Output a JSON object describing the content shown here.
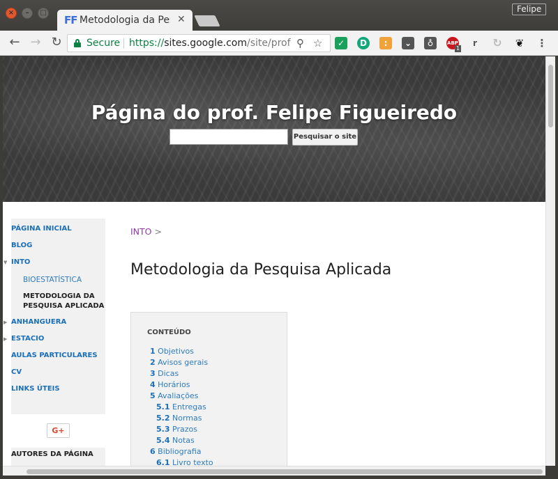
{
  "browser": {
    "tab_title": "Metodologia da Pesquisa Aplicada",
    "tab_close": "✕",
    "profile": "Felipe",
    "secure_label": "Secure",
    "url_scheme": "https://",
    "url_host": "sites.google.com",
    "url_path": "/site/prof...",
    "icons": [
      "back-icon",
      "forward-icon",
      "reload-icon",
      "lock-icon",
      "zoom-icon",
      "star-icon",
      "menu-icon"
    ],
    "extensions": [
      "check-extension",
      "pinterest-extension",
      "honey-extension",
      "pocket-extension",
      "bulb-extension",
      "adblock-extension",
      "r-extension",
      "refresh-extension",
      "paw-extension"
    ],
    "abp_badge": "1",
    "abp_label": "ABP",
    "r_label": "r"
  },
  "site": {
    "title": "Página do prof. Felipe Figueiredo",
    "search_button": "Pesquisar o site",
    "search_value": ""
  },
  "sidebar": {
    "items": [
      {
        "label": "PÁGINA INICIAL"
      },
      {
        "label": "BLOG"
      },
      {
        "label": "INTO"
      },
      {
        "label": "BIOESTATÍSTICA"
      },
      {
        "label": "METODOLOGIA DA PESQUISA APLICADA"
      },
      {
        "label": "ANHANGUERA"
      },
      {
        "label": "ESTACIO"
      },
      {
        "label": "AULAS PARTICULARES"
      },
      {
        "label": "CV"
      },
      {
        "label": "LINKS ÚTEIS"
      }
    ],
    "current_line1": "METODOLOGIA DA",
    "current_line2": "PESQUISA APLICADA",
    "gplus": "G+",
    "authors": "AUTORES DA PÁGINA"
  },
  "main": {
    "breadcrumb": {
      "crumb": "INTO",
      "sep": ">"
    },
    "title": "Metodologia da Pesquisa Aplicada",
    "toc": {
      "heading": "CONTEÚDO",
      "items": [
        {
          "num": "1",
          "label": "Objetivos"
        },
        {
          "num": "2",
          "label": "Avisos gerais"
        },
        {
          "num": "3",
          "label": "Dicas"
        },
        {
          "num": "4",
          "label": "Horários"
        },
        {
          "num": "5",
          "label": "Avaliações"
        },
        {
          "num": "5.1",
          "label": "Entregas"
        },
        {
          "num": "5.2",
          "label": "Normas"
        },
        {
          "num": "5.3",
          "label": "Prazos"
        },
        {
          "num": "5.4",
          "label": "Notas"
        },
        {
          "num": "6",
          "label": "Bibliografia"
        },
        {
          "num": "6.1",
          "label": "Livro texto"
        }
      ]
    }
  }
}
